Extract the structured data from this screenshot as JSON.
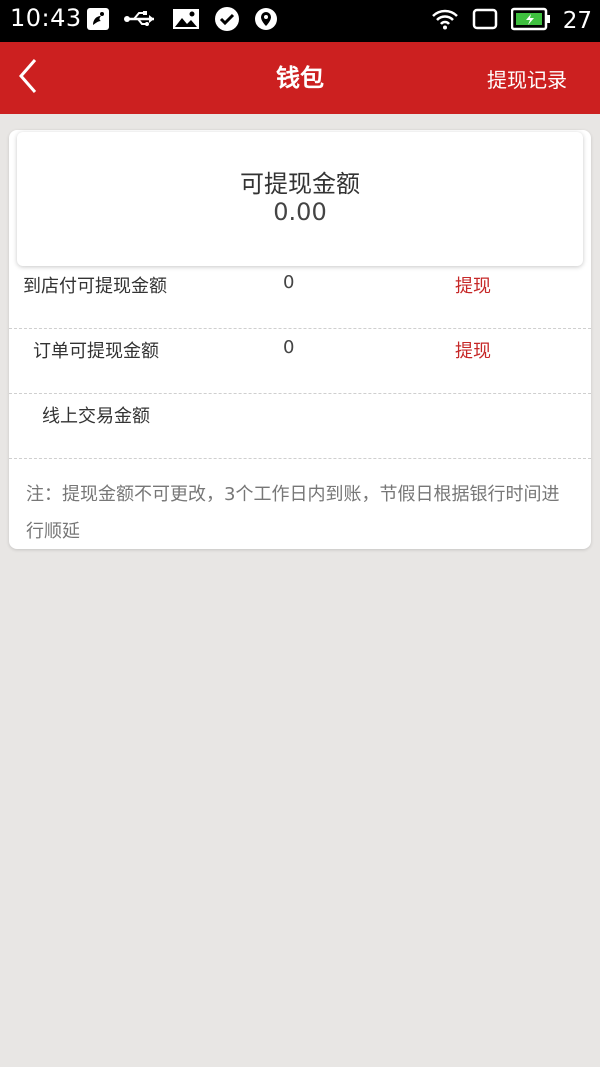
{
  "status_bar": {
    "time": "10:43",
    "battery_level": "27",
    "left_icons": [
      "squirrel-app-icon",
      "usb-icon",
      "image-icon",
      "check-circle-icon",
      "location-shield-icon"
    ],
    "right_icons": [
      "wifi-icon",
      "screen-rotate-icon",
      "battery-charging-icon"
    ]
  },
  "header": {
    "title": "钱包",
    "action_label": "提现记录",
    "back_icon": "chevron-left-icon",
    "background_color": "#cc2020"
  },
  "summary": {
    "label": "可提现金额",
    "value": "0.00"
  },
  "rows": [
    {
      "label": "到店付可提现金额",
      "value": "0",
      "action": "提现"
    },
    {
      "label": "订单可提现金额",
      "value": "0",
      "action": "提现"
    },
    {
      "label": "线上交易金额",
      "value": "",
      "action": ""
    }
  ],
  "note": "注：提现金额不可更改，3个工作日内到账，节假日根据银行时间进行顺延",
  "colors": {
    "accent": "#c62828",
    "page_background": "#e8e6e4"
  }
}
